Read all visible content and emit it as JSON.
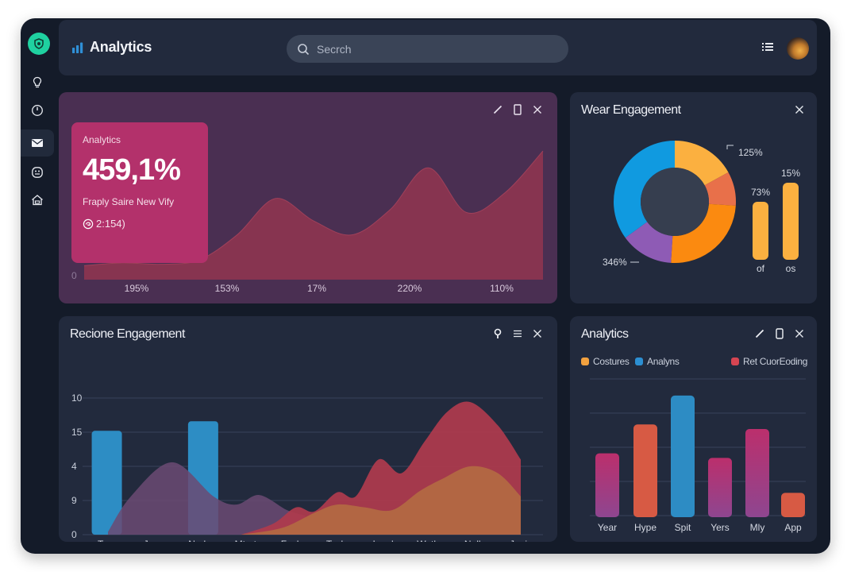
{
  "app": {
    "title": "Analytics",
    "search": {
      "placeholder": "Secrch",
      "value": ""
    }
  },
  "sidebar": {
    "items": [
      {
        "name": "lightbulb-icon",
        "active": false
      },
      {
        "name": "clock-icon",
        "active": false
      },
      {
        "name": "mail-icon",
        "active": true
      },
      {
        "name": "badge-icon",
        "active": false
      },
      {
        "name": "home-icon",
        "active": false
      }
    ]
  },
  "hero": {
    "stat_label": "Analytics",
    "stat_value": "459,1%",
    "stat_desc": "Fraply Saire New Vify",
    "stat_foot": "2:154)",
    "y_tick": "0",
    "x_ticks": [
      "195%",
      "153%",
      "17%",
      "220%",
      "110%"
    ],
    "colors": {
      "card": "#4a2f52",
      "area": "#8a3550",
      "stat": "#b3316b"
    }
  },
  "donut_card": {
    "title": "Wear Engagement",
    "label_top": "125%",
    "label_bottom": "346%",
    "bar_labels": [
      "73%",
      "15%"
    ],
    "bar_cats": [
      "of",
      "os"
    ]
  },
  "area_card": {
    "title": "Recione Engagement",
    "y_ticks": [
      "10",
      "15",
      "4",
      "9",
      "0"
    ],
    "x_ticks": [
      "Tane",
      "June",
      "Neda",
      "Mtprt",
      "Foch",
      "Tasle",
      "Lacd",
      "Wotle",
      "Nolly",
      "Jepis"
    ]
  },
  "bars_card": {
    "title": "Analytics",
    "legend": [
      {
        "label": "Costures",
        "color": "#f2a13f"
      },
      {
        "label": "Analyns",
        "color": "#2c8fd2"
      },
      {
        "label": "Ret CuorEoding",
        "color": "#d64552"
      }
    ]
  },
  "chart_data": [
    {
      "type": "area",
      "title": "",
      "x": [
        0,
        1,
        2,
        3,
        4,
        5,
        6,
        7,
        8,
        9,
        10,
        11,
        12
      ],
      "series": [
        {
          "name": "hero-series",
          "values": [
            10,
            12,
            11,
            14,
            32,
            58,
            42,
            32,
            50,
            80,
            48,
            62,
            92
          ]
        }
      ],
      "x_tick_labels": [
        "195%",
        "153%",
        "17%",
        "220%",
        "110%"
      ],
      "ylim": [
        0,
        100
      ],
      "color": "#8a3550"
    },
    {
      "type": "pie",
      "title": "Wear Engagement",
      "donut": true,
      "slices": [
        {
          "name": "yellow",
          "value": 17,
          "color": "#fbb040"
        },
        {
          "name": "coral",
          "value": 9,
          "color": "#e8704a"
        },
        {
          "name": "orange",
          "value": 25,
          "color": "#fb8a10"
        },
        {
          "name": "purple",
          "value": 14,
          "color": "#8e5bb5"
        },
        {
          "name": "blue",
          "value": 35,
          "color": "#109ae0"
        }
      ],
      "annotations": [
        "125%",
        "346%"
      ]
    },
    {
      "type": "bar",
      "title": "Wear Engagement mini bars",
      "categories": [
        "of",
        "os"
      ],
      "values": [
        73,
        97
      ],
      "value_labels": [
        "73%",
        "15%"
      ],
      "ylim": [
        0,
        100
      ],
      "color": "#fbb040"
    },
    {
      "type": "area",
      "title": "Recione Engagement",
      "categories": [
        "Tane",
        "June",
        "Neda",
        "Mtprt",
        "Foch",
        "Tasle",
        "Lacd",
        "Wotle",
        "Nolly",
        "Jepis"
      ],
      "y_tick_labels": [
        "10",
        "15",
        "4",
        "9",
        "0"
      ],
      "ylim": [
        0,
        100
      ],
      "bars": {
        "name": "blue-bars",
        "color": "#2d8dc4",
        "items": [
          {
            "x": 0.2,
            "value": 76
          },
          {
            "x": 2.3,
            "value": 83
          }
        ]
      },
      "series": [
        {
          "name": "purple",
          "color": "#6b4a73",
          "x": [
            0,
            0.5,
            1.4,
            2.3,
            2.8,
            3.3,
            3.9,
            4.3
          ],
          "values": [
            2,
            28,
            53,
            28,
            22,
            29,
            18,
            14
          ]
        },
        {
          "name": "red",
          "color": "#b03b4d",
          "x": [
            2.9,
            3.6,
            4.1,
            4.5,
            5.0,
            5.4,
            5.9,
            6.4,
            6.9,
            7.4,
            7.9,
            8.5,
            9.0
          ],
          "values": [
            0,
            8,
            20,
            17,
            31,
            28,
            55,
            45,
            68,
            90,
            97,
            80,
            55
          ]
        },
        {
          "name": "orange",
          "color": "#b36a42",
          "x": [
            2.9,
            3.8,
            4.5,
            5.0,
            5.6,
            6.2,
            6.8,
            7.3,
            7.9,
            8.5,
            9.0
          ],
          "values": [
            0,
            5,
            16,
            22,
            20,
            18,
            32,
            41,
            50,
            45,
            28
          ]
        }
      ]
    },
    {
      "type": "bar",
      "title": "Analytics",
      "categories": [
        "Year",
        "Hype",
        "Spit",
        "Yers",
        "Mly",
        "App"
      ],
      "values": [
        42,
        61,
        80,
        39,
        58,
        16
      ],
      "colors": [
        "#b3336f",
        "#d75a44",
        "#2d8cc4",
        "#b3336f",
        "#b3336f",
        "#d75a44"
      ],
      "legend": [
        "Costures",
        "Analyns",
        "Ret CuorEoding"
      ],
      "ylim": [
        0,
        100
      ],
      "grid": true
    }
  ]
}
